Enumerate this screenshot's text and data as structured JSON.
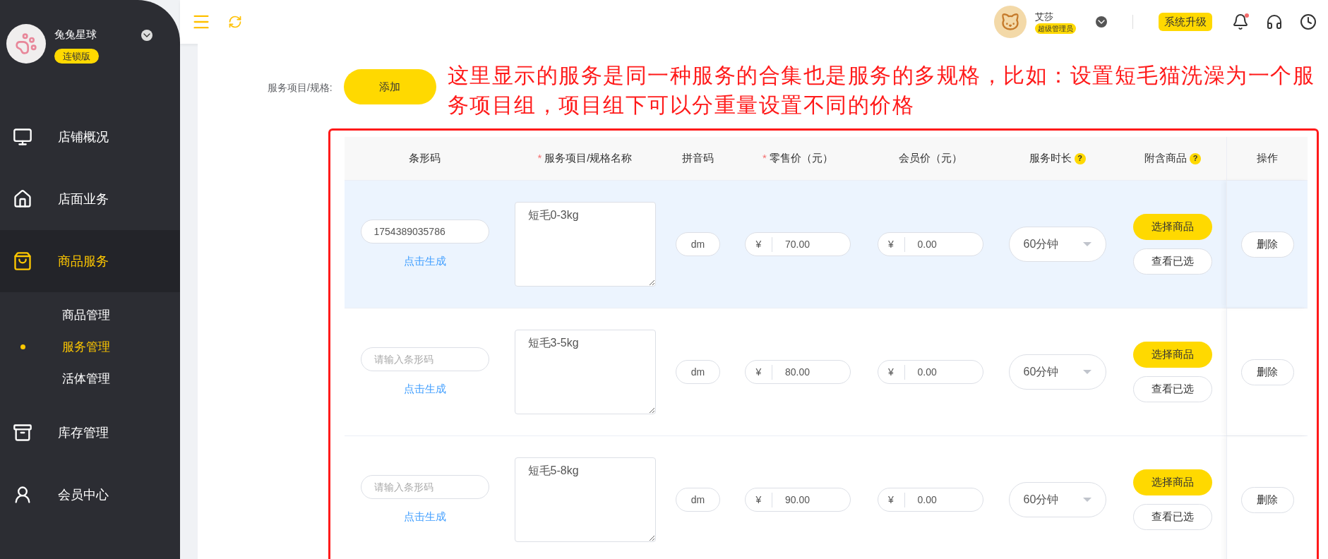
{
  "sidebar": {
    "store_name": "兔兔星球",
    "badge": "连锁版",
    "menu": [
      {
        "label": "店铺概况",
        "selected": false
      },
      {
        "label": "店面业务",
        "selected": false
      },
      {
        "label": "商品服务",
        "selected": true,
        "children": [
          {
            "label": "商品管理",
            "selected": false
          },
          {
            "label": "服务管理",
            "selected": true
          },
          {
            "label": "活体管理",
            "selected": false
          }
        ]
      },
      {
        "label": "库存管理",
        "selected": false
      },
      {
        "label": "会员中心",
        "selected": false
      }
    ]
  },
  "header": {
    "user_name": "艾莎",
    "role": "超级管理员",
    "upgrade_button": "系统升级",
    "notification_dot": true
  },
  "form": {
    "label": "服务项目/规格:",
    "add_button": "添加",
    "annotation": "这里显示的服务是同一种服务的合集也是服务的多规格，比如：设置短毛猫洗澡为一个服务项目组，项目组下可以分重量设置不同的价格"
  },
  "table": {
    "columns": [
      {
        "label": "条形码"
      },
      {
        "label": "服务项目/规格名称",
        "required_mark": "*"
      },
      {
        "label": "拼音码"
      },
      {
        "label": "零售价（元）",
        "required_mark": "*"
      },
      {
        "label": "会员价（元）"
      },
      {
        "label": "服务时长",
        "help_mark": "?"
      },
      {
        "label": "附含商品",
        "help_mark": "?"
      },
      {
        "label": "操作"
      }
    ],
    "rows": [
      {
        "selected": true,
        "barcode": "1754389035786",
        "generate_link": "点击生成",
        "name": "短毛0-3kg",
        "pinyin": "dm",
        "currency": "¥",
        "retail_price": "70.00",
        "member_currency": "¥",
        "member_price": "0.00",
        "duration": "60分钟",
        "select_button": "选择商品",
        "view_button": "查看已选",
        "delete_button": "删除"
      },
      {
        "selected": false,
        "barcode_placeholder": "请输入条形码",
        "generate_link": "点击生成",
        "name": "短毛3-5kg",
        "pinyin": "dm",
        "currency": "¥",
        "retail_price": "80.00",
        "member_currency": "¥",
        "member_price": "0.00",
        "duration": "60分钟",
        "select_button": "选择商品",
        "view_button": "查看已选",
        "delete_button": "删除"
      },
      {
        "selected": false,
        "barcode_placeholder": "请输入条形码",
        "generate_link": "点击生成",
        "name": "短毛5-8kg",
        "pinyin": "dm",
        "currency": "¥",
        "retail_price": "90.00",
        "member_currency": "¥",
        "member_price": "0.00",
        "duration": "60分钟",
        "select_button": "选择商品",
        "view_button": "查看已选",
        "delete_button": "删除"
      }
    ]
  }
}
